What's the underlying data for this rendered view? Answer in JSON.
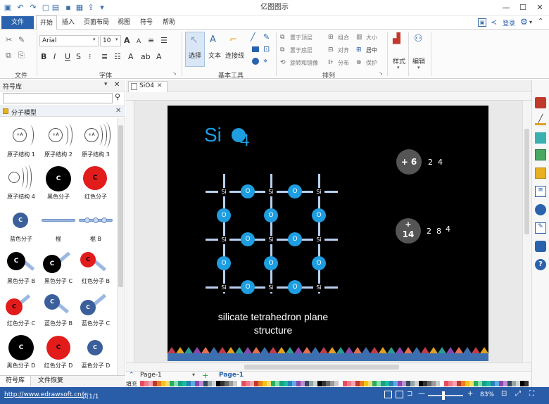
{
  "app": {
    "title": "亿图图示"
  },
  "menu": {
    "file": "文件",
    "tabs": [
      "开始",
      "插入",
      "页面布局",
      "视图",
      "符号",
      "帮助"
    ],
    "login": "登录"
  },
  "ribbon": {
    "groups": {
      "file": "文件",
      "font": "字体",
      "basic_tools": "基本工具",
      "arrange": "排列"
    },
    "font_name": "Arial",
    "font_size": "10",
    "tools": {
      "select": "选择",
      "text": "文本",
      "connector": "连接线"
    },
    "arrange": {
      "bring_front": "置于顶层",
      "send_back": "置于底层",
      "rotate": "旋转和镜像",
      "group": "组合",
      "align": "对齐",
      "distribute": "分布",
      "size": "大小",
      "center": "居中",
      "protect": "保护"
    },
    "style": "样式",
    "edit": "编辑"
  },
  "sidebar": {
    "title": "符号库",
    "category": "分子模型",
    "symbols": [
      "原子结构 1",
      "原子结构 2",
      "原子结构 3",
      "原子结构 4",
      "黑色分子",
      "红色分子",
      "蓝色分子",
      "棍",
      "棍 B",
      "黑色分子 B",
      "黑色分子 C",
      "红色分子 B",
      "红色分子 C",
      "蓝色分子 B",
      "蓝色分子 C",
      "黑色分子 D",
      "红色分子 D",
      "蓝色分子 D"
    ],
    "atom_letter": "C",
    "atom_plus": "+A",
    "tabs": [
      "符号库",
      "文件恢复"
    ]
  },
  "document": {
    "tab": "SiO4",
    "page_dropdown": "Page-1",
    "page_tab": "Page-1",
    "fill_label": "填充"
  },
  "slide": {
    "title_si": "Si",
    "title_4": "4",
    "caption_line1": "silicate tetrahedron plane",
    "caption_line2": "structure",
    "atom_si": "Si",
    "atom_o": "O",
    "badge1": {
      "nucleus": "+ 6",
      "shells": "2  4"
    },
    "badge2": {
      "nucleus_top": "+",
      "nucleus_bottom": "14",
      "shells": "2  8",
      "shell_extra": "4"
    }
  },
  "status": {
    "url": "http://www.edrawsoft.cn/",
    "page": "页1/1",
    "zoom": "83%"
  },
  "colors": {
    "accent": "#2a62ad",
    "oxygen": "#1e9ee0",
    "bond": "#b8d0ee",
    "status": "#2a5da8"
  }
}
